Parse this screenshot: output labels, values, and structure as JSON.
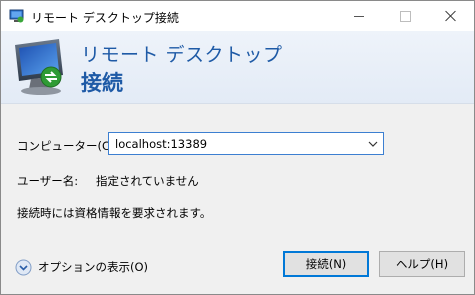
{
  "window": {
    "title": "リモート デスクトップ接続"
  },
  "banner": {
    "line1": "リモート デスクトップ",
    "line2": "接続"
  },
  "form": {
    "computer_label": "コンピューター(C):",
    "computer_value": "localhost:13389",
    "user_label": "ユーザー名:",
    "user_value": "指定されていません",
    "note": "接続時には資格情報を要求されます。"
  },
  "footer": {
    "options_label": "オプションの表示(O)",
    "connect_label": "接続(N)",
    "help_label": "ヘルプ(H)"
  },
  "colors": {
    "accent": "#0078d7",
    "banner_text": "#1e5aa6"
  },
  "icons": {
    "app": "remote-desktop-icon",
    "options": "chevron-down-circle-icon",
    "combo": "chevron-down-icon"
  }
}
